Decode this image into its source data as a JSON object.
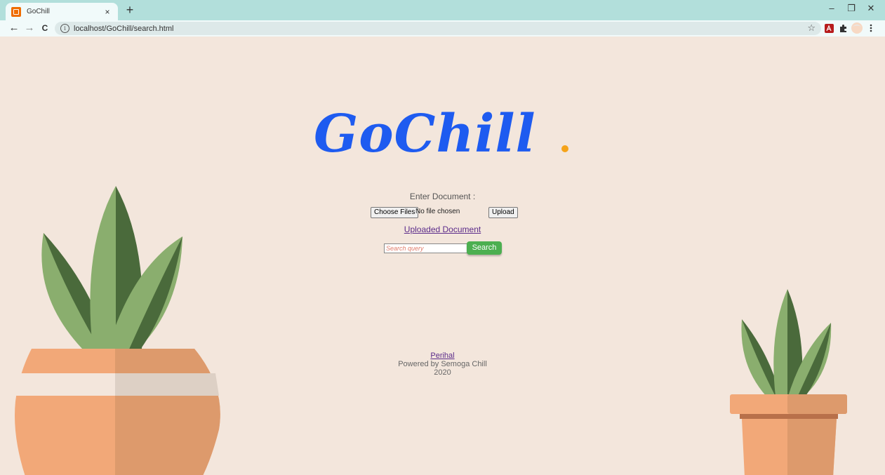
{
  "browser": {
    "tab_title": "GoChill",
    "tab_close": "×",
    "new_tab": "+",
    "url": "localhost/GoChill/search.html",
    "window_controls": [
      "–",
      "❐",
      "✕"
    ],
    "nav": {
      "back": "←",
      "forward": "→",
      "reload": "C"
    },
    "bookmark_star": "☆",
    "extension_icons": [
      "pdf-extension-icon",
      "puzzle-extension-icon",
      "profile-avatar-icon",
      "kebab-menu-icon"
    ]
  },
  "page": {
    "logo": "GoChill",
    "logo_dot_color": "#f5a31a",
    "logo_color": "#1e5bf0",
    "upload_label": "Enter Document :",
    "choose_files_label": "Choose Files",
    "no_file_text": "No file chosen",
    "upload_button": "Upload",
    "uploaded_link": "Uploaded Document",
    "search_placeholder": "Search query",
    "search_button": "Search",
    "footer_link": "Perihal",
    "footer_powered": "Powered by Semoga Chill",
    "footer_year": "2020"
  },
  "colors": {
    "background": "#f3e6dc",
    "tabstrip": "#b2dfdb",
    "search_button": "#4caf50",
    "pot": "#f2a878",
    "leaf_light": "#8aae6e",
    "leaf_dark": "#4a6a3b"
  }
}
